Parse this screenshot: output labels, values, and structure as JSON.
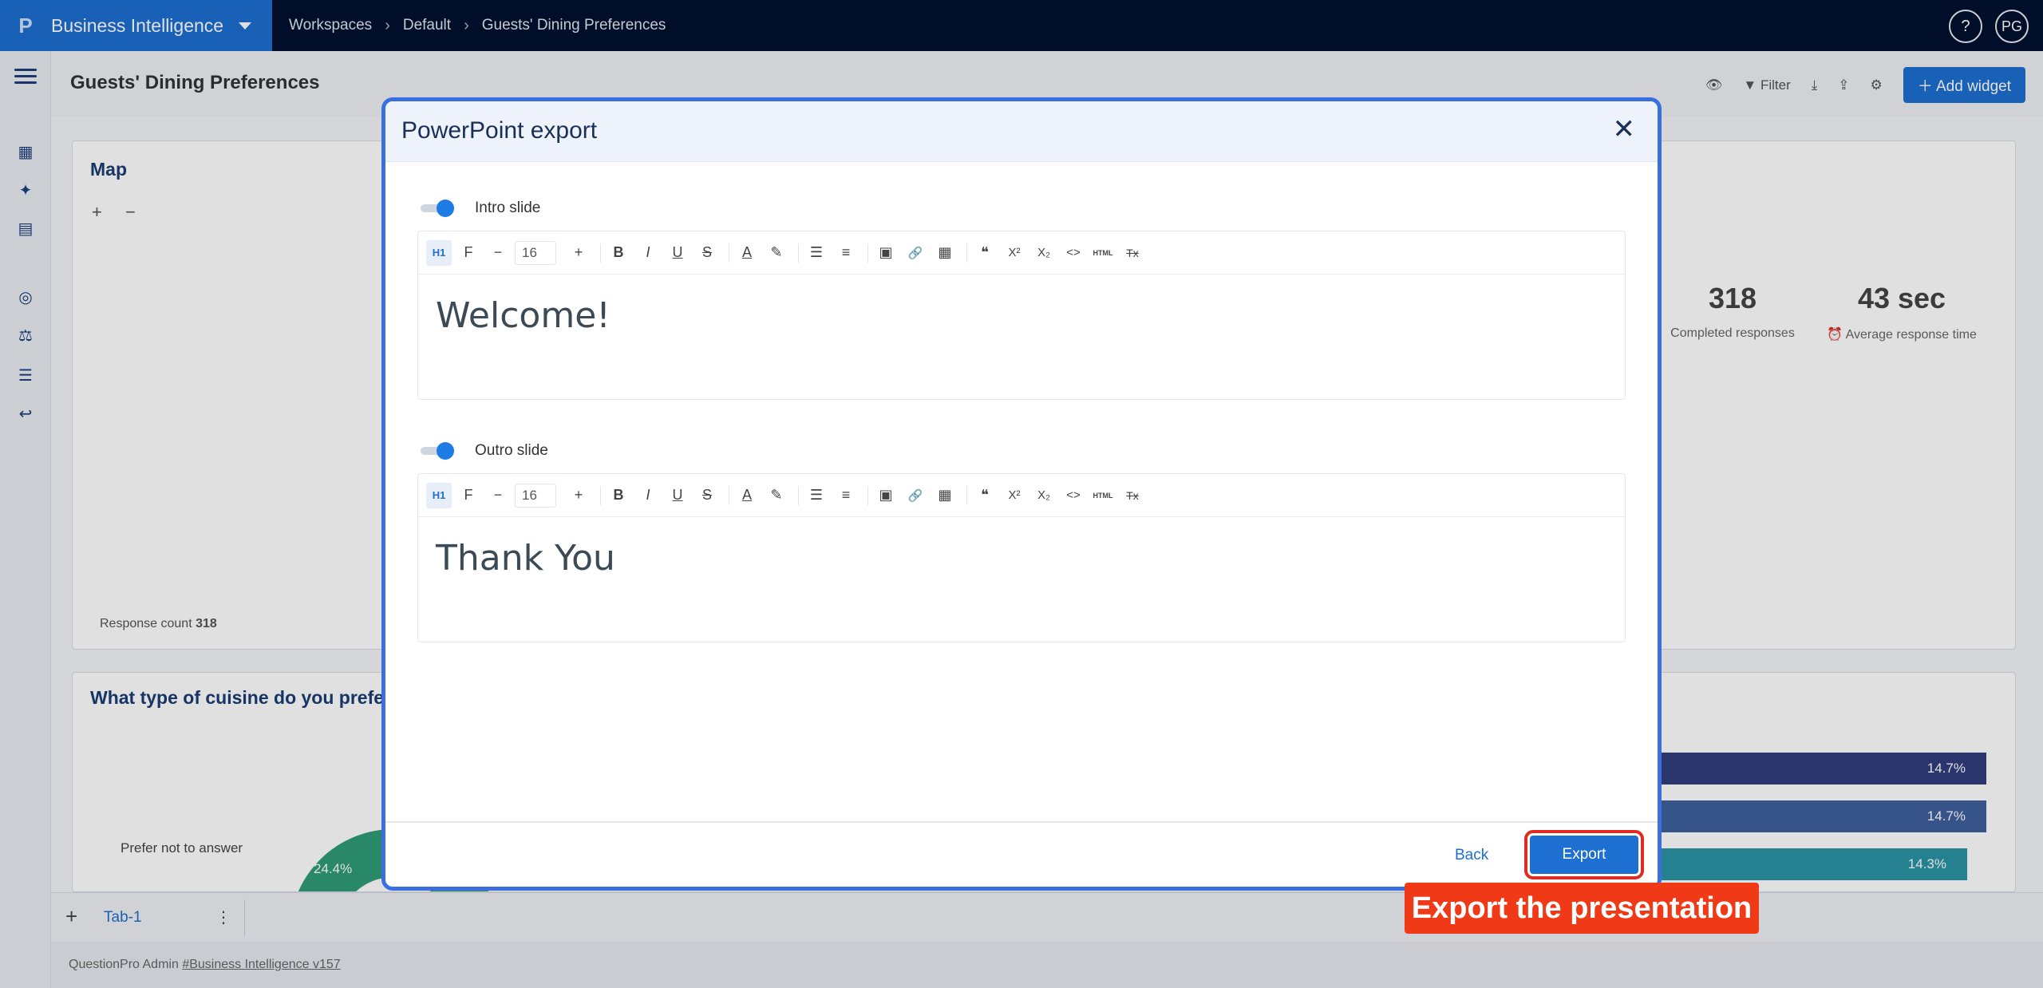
{
  "app": {
    "name": "Business Intelligence",
    "logo_letter": "P",
    "avatar": "PG",
    "help": "?"
  },
  "breadcrumb": [
    "Workspaces",
    "Default",
    "Guests' Dining Preferences"
  ],
  "page": {
    "title": "Guests' Dining Preferences",
    "filter_label": "Filter",
    "add_widget_label": "Add widget"
  },
  "map_card": {
    "title": "Map",
    "zoom_in": "+",
    "zoom_out": "−",
    "response_count_label": "Response count",
    "response_count_value": "318"
  },
  "stats": [
    {
      "value": "318",
      "label": "Completed responses"
    },
    {
      "value": "43 sec",
      "label": "Average response time"
    }
  ],
  "cuisine_card": {
    "title": "What type of cuisine do you prefer?",
    "legend_label": "Prefer not to answer",
    "pie_label": "24.4%",
    "bars": [
      {
        "value": "14.7%",
        "fraction": 0.147,
        "color": "#2f3d7c"
      },
      {
        "value": "14.7%",
        "fraction": 0.147,
        "color": "#3e5f9e"
      },
      {
        "value": "14.3%",
        "fraction": 0.143,
        "color": "#2b93a3"
      }
    ]
  },
  "tabs": {
    "add": "+",
    "tab1": "Tab-1",
    "menu": "⋮"
  },
  "footer": {
    "prefix": "QuestionPro Admin",
    "link": "#Business Intelligence v157"
  },
  "modal": {
    "title": "PowerPoint export",
    "close": "✕",
    "intro": {
      "label": "Intro slide",
      "font_size": "16",
      "content": "Welcome!"
    },
    "outro": {
      "label": "Outro slide",
      "font_size": "16",
      "content": "Thank You"
    },
    "back_label": "Back",
    "export_label": "Export"
  },
  "callout": "Export the presentation",
  "toolbar": {
    "heading": "H1",
    "font": "F",
    "minus": "−",
    "plus": "+",
    "bold": "B",
    "italic": "I",
    "underline": "U",
    "strike": "S",
    "text_color": "A",
    "highlight": "✎",
    "list": "☰",
    "align": "≡",
    "image": "▣",
    "link": "🔗",
    "table": "▦",
    "quote": "❝",
    "sup": "X²",
    "sub": "X₂",
    "code": "<>",
    "html": "HTML",
    "clear": "Tx"
  }
}
